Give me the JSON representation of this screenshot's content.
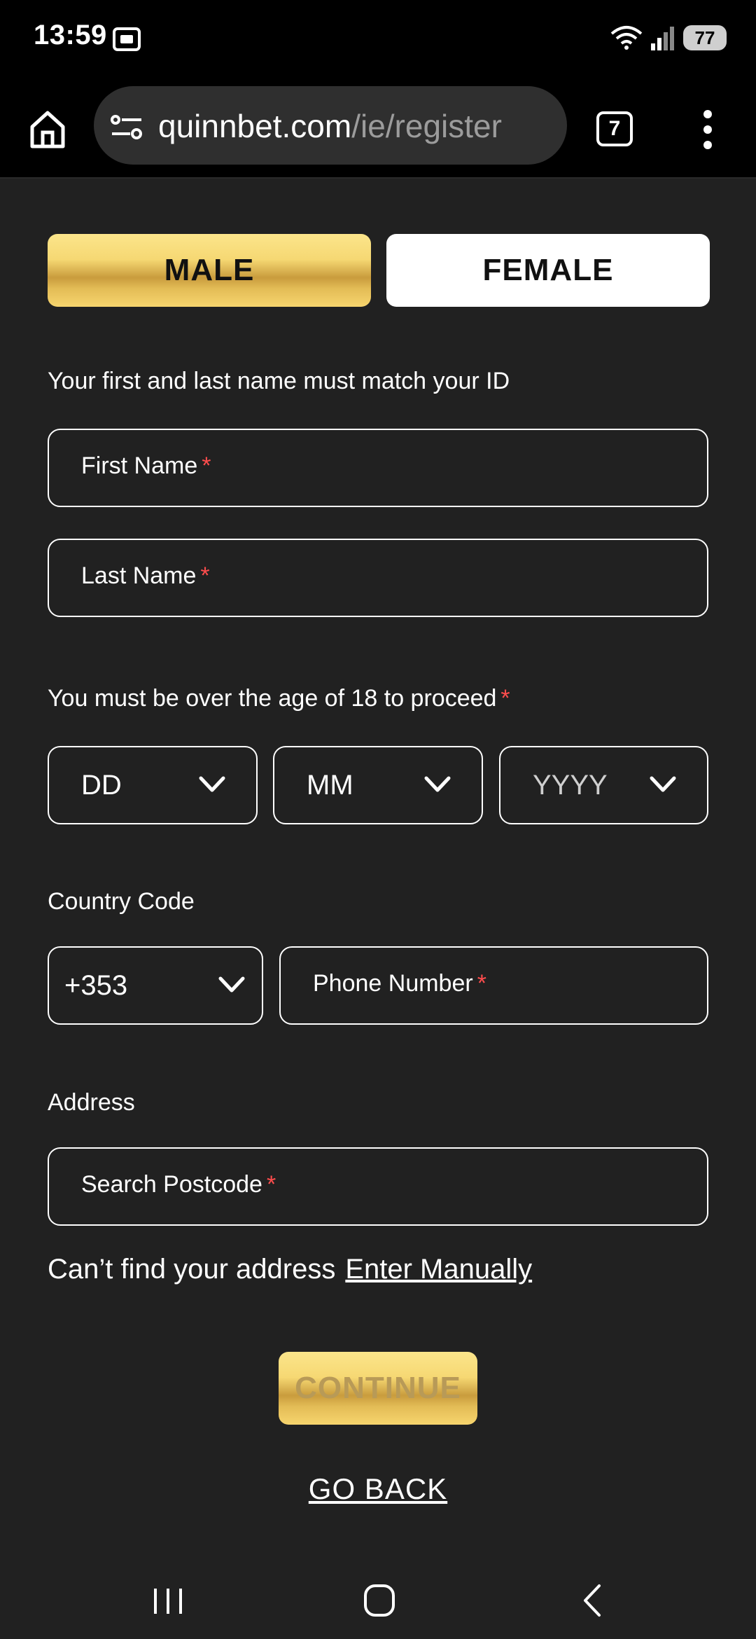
{
  "status_bar": {
    "time": "13:59",
    "battery": "77"
  },
  "browser": {
    "url_host": "quinnbet.com",
    "url_path": "/ie/register",
    "tab_count": "7"
  },
  "gender": {
    "male_label": "MALE",
    "female_label": "FEMALE",
    "selected": "MALE"
  },
  "name_section": {
    "note": "Your first and last name must match your ID",
    "first_name_placeholder": "First Name",
    "last_name_placeholder": "Last Name",
    "required_marker": "*"
  },
  "dob_section": {
    "note": "You must be over the age of 18 to proceed",
    "required_marker": "*",
    "day": "DD",
    "month": "MM",
    "year": "YYYY"
  },
  "phone_section": {
    "country_code_label": "Country Code",
    "country_code_value": "+353",
    "phone_placeholder": "Phone Number",
    "required_marker": "*"
  },
  "address_section": {
    "label": "Address",
    "postcode_placeholder": "Search Postcode",
    "required_marker": "*",
    "cant_find_text": "Can’t find your address",
    "enter_manually_link": "Enter Manually"
  },
  "actions": {
    "continue_label": "CONTINUE",
    "go_back_label": "GO BACK"
  },
  "colors": {
    "background": "#212121",
    "gold_accent": "#f6d873",
    "required": "#ff4d4d"
  }
}
